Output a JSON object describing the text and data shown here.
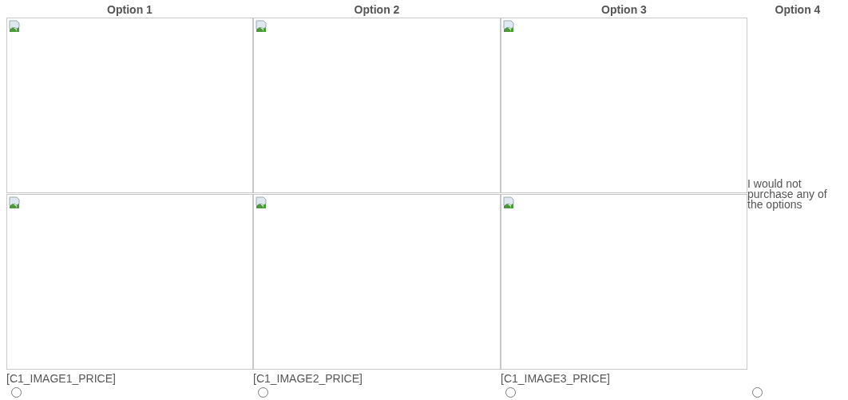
{
  "options": [
    {
      "kind": "product",
      "heading": "Option 1",
      "images": [
        {
          "kind": "broken"
        },
        {
          "kind": "broken"
        }
      ],
      "price": "[C1_IMAGE1_PRICE]",
      "selected": false
    },
    {
      "kind": "product",
      "heading": "Option 2",
      "images": [
        {
          "kind": "broken"
        },
        {
          "kind": "broken"
        }
      ],
      "price": "[C1_IMAGE2_PRICE]",
      "selected": false
    },
    {
      "kind": "product",
      "heading": "Option 3",
      "images": [
        {
          "kind": "broken"
        },
        {
          "kind": "broken"
        }
      ],
      "price": "[C1_IMAGE3_PRICE]",
      "selected": false
    },
    {
      "kind": "none",
      "heading": "Option 4",
      "label": "I would not purchase any of the options",
      "selected": false
    }
  ]
}
